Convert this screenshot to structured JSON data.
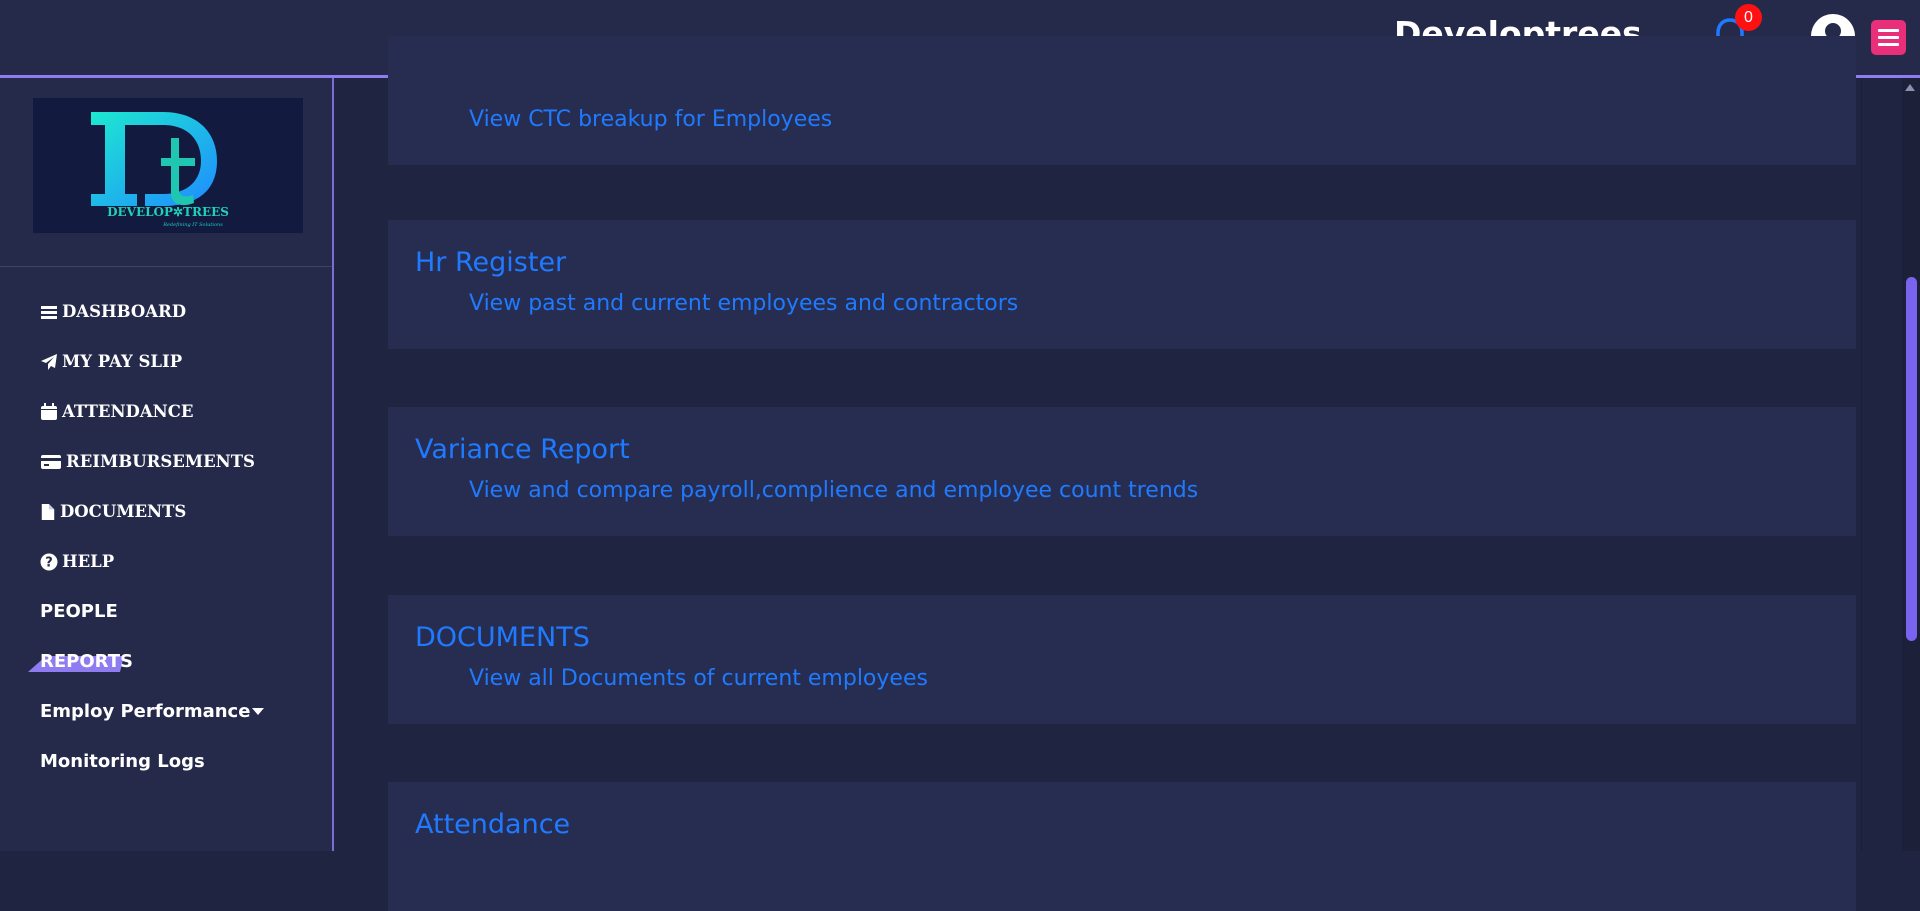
{
  "header": {
    "title": "Developtrees",
    "notification_count": "0"
  },
  "logo": {
    "letters": "Dt",
    "brand": "DEVELOPTREES",
    "tagline": "Redefining IT Solutions"
  },
  "sidebar": {
    "items": [
      {
        "label": "DASHBOARD",
        "icon": "bars-icon"
      },
      {
        "label": "MY PAY SLIP",
        "icon": "paper-plane-icon"
      },
      {
        "label": "ATTENDANCE",
        "icon": "calendar-icon"
      },
      {
        "label": "REIMBURSEMENTS",
        "icon": "credit-card-icon"
      },
      {
        "label": "DOCUMENTS",
        "icon": "file-icon"
      },
      {
        "label": "HELP",
        "icon": "question-circle-icon"
      },
      {
        "label": "PEOPLE"
      },
      {
        "label": "REPORTS",
        "active": true
      },
      {
        "label": "Employ Performance",
        "icon": "caret-down-icon"
      },
      {
        "label": "Monitoring Logs"
      }
    ]
  },
  "reports": [
    {
      "title": "",
      "link": "View CTC breakup for Employees"
    },
    {
      "title": "Hr Register",
      "link": "View past and current employees and contractors"
    },
    {
      "title": "Variance Report",
      "link": "View and compare payroll,complience and employee count trends"
    },
    {
      "title": "DOCUMENTS",
      "link": "View all Documents of current employees"
    },
    {
      "title": "Attendance",
      "link": ""
    }
  ],
  "colors": {
    "background": "#1f2440",
    "panel": "#252a4a",
    "card": "#272d50",
    "accent": "#8e7cf0",
    "link": "#1f7aff",
    "badge": "#ff1111",
    "menu_button": "#ea2f7a"
  }
}
